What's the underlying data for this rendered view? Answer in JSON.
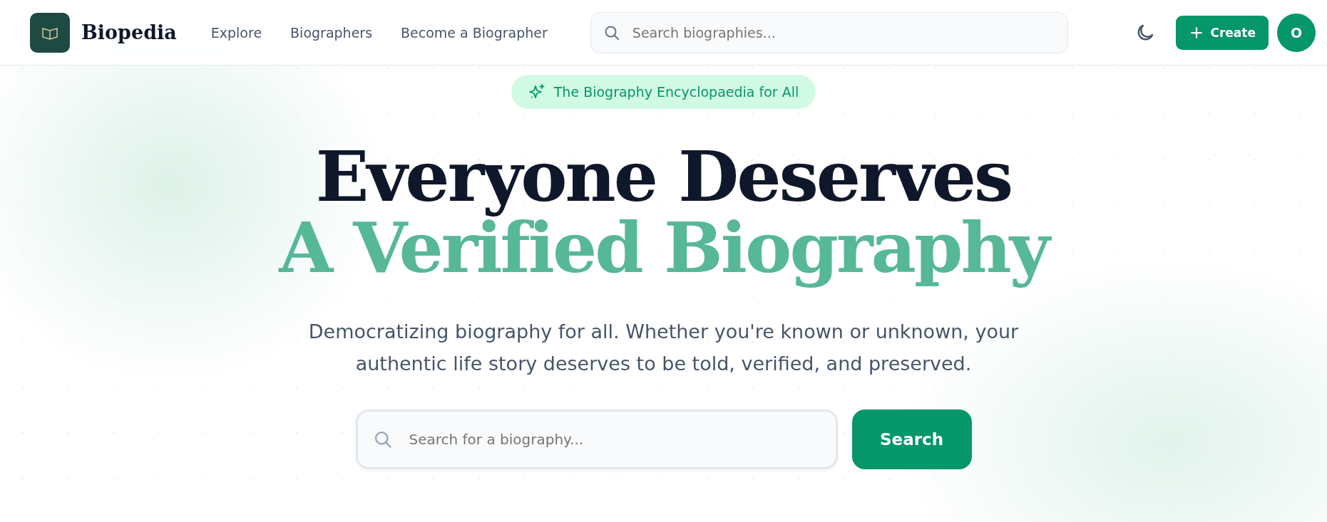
{
  "brand": {
    "name": "Biopedia"
  },
  "nav": [
    {
      "label": "Explore"
    },
    {
      "label": "Biographers"
    },
    {
      "label": "Become a Biographer"
    }
  ],
  "header_search": {
    "placeholder": "Search biographies..."
  },
  "create_button": {
    "label": "Create"
  },
  "avatar": {
    "initial": "O"
  },
  "hero": {
    "badge": "The Biography Encyclopaedia for All",
    "title_line_1": "Everyone Deserves",
    "title_line_2": "A Verified Biography",
    "subtitle": "Democratizing biography for all. Whether you're known or unknown, your authentic life story deserves to be told, verified, and preserved.",
    "search": {
      "placeholder": "Search for a biography..."
    },
    "search_button": "Search"
  }
}
